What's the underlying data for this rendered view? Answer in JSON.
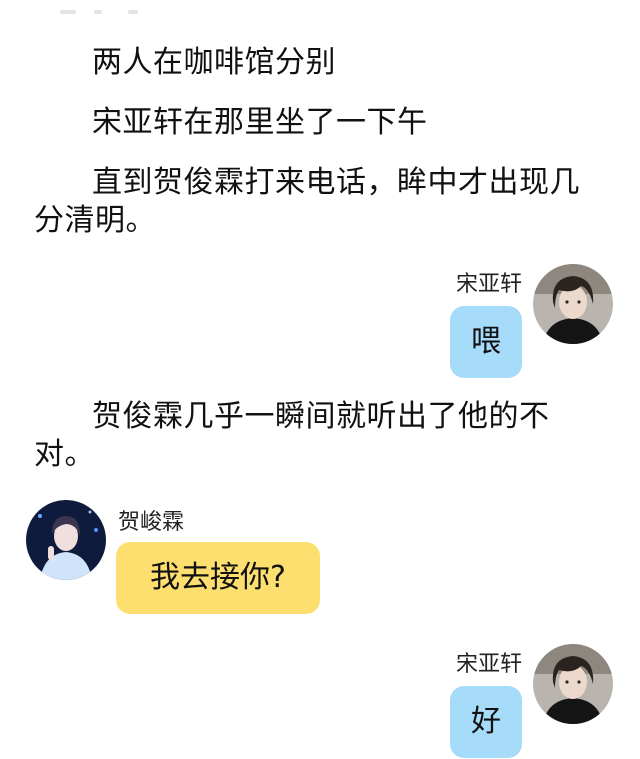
{
  "colors": {
    "self_bubble": "#a7dbfa",
    "other_bubble": "#fddf70",
    "background": "#ffffff"
  },
  "narration": [
    "两人在咖啡馆分别",
    "宋亚轩在那里坐了一下午",
    "直到贺俊霖打来电话，眸中才出现几分清明。",
    "贺俊霖几乎一瞬间就听出了他的不对。"
  ],
  "messages": [
    {
      "speaker": "宋亚轩",
      "text": "喂",
      "side": "right",
      "avatar_icon": "avatar-dark-hair-icon"
    },
    {
      "speaker": "贺峻霖",
      "text": "我去接你?",
      "side": "left",
      "avatar_icon": "avatar-blue-stage-icon"
    },
    {
      "speaker": "宋亚轩",
      "text": "好",
      "side": "right",
      "avatar_icon": "avatar-dark-hair-icon"
    }
  ]
}
